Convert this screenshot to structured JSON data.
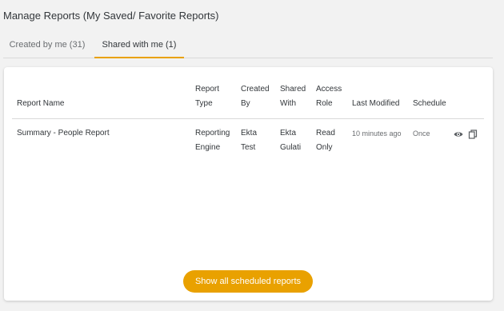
{
  "page": {
    "title": "Manage Reports (My Saved/ Favorite Reports)"
  },
  "tabs": [
    {
      "label": "Created by me (31)"
    },
    {
      "label": "Shared with me (1)"
    }
  ],
  "table": {
    "headers": {
      "report_name": "Report Name",
      "report_type": [
        "Report",
        "Type"
      ],
      "created_by": [
        "Created",
        "By"
      ],
      "shared_with": [
        "Shared",
        "With"
      ],
      "access_role": [
        "Access",
        "Role"
      ],
      "last_modified": "Last Modified",
      "schedule": "Schedule"
    },
    "rows": [
      {
        "report_name": "Summary - People Report",
        "report_type": [
          "Reporting",
          "Engine"
        ],
        "created_by": [
          "Ekta",
          "Test"
        ],
        "shared_with": [
          "Ekta",
          "Gulati"
        ],
        "access_role": [
          "Read",
          "Only"
        ],
        "last_modified": "10 minutes ago",
        "schedule": "Once",
        "actions": [
          "eye-icon",
          "copy-icon"
        ]
      }
    ]
  },
  "button": {
    "show_scheduled": "Show all scheduled reports"
  },
  "colors": {
    "accent": "#e9a100",
    "background": "#f2f2f2",
    "card": "#ffffff"
  }
}
